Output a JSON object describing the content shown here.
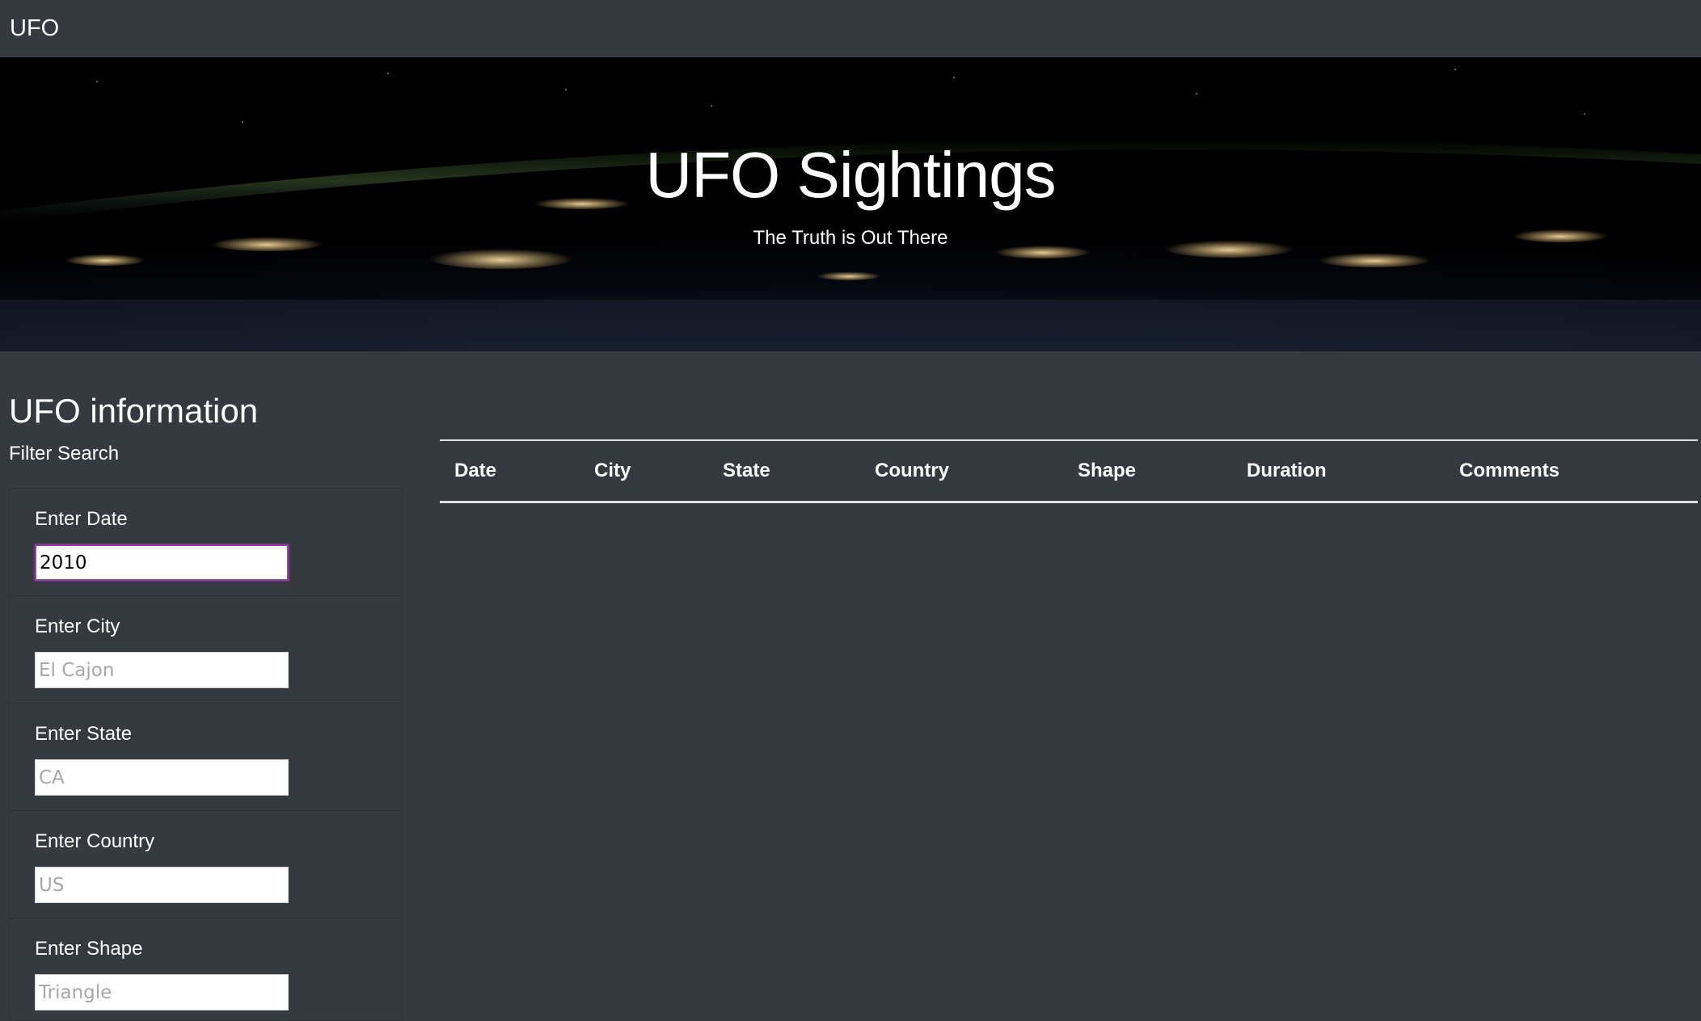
{
  "navbar": {
    "brand": "UFO"
  },
  "hero": {
    "title": "UFO Sightings",
    "subtitle": "The Truth is Out There"
  },
  "main": {
    "section_title": "UFO information",
    "filter_title": "Filter Search"
  },
  "filters": [
    {
      "label": "Enter Date",
      "value": "2010",
      "placeholder": ""
    },
    {
      "label": "Enter City",
      "value": "",
      "placeholder": "El Cajon"
    },
    {
      "label": "Enter State",
      "value": "",
      "placeholder": "CA"
    },
    {
      "label": "Enter Country",
      "value": "",
      "placeholder": "US"
    },
    {
      "label": "Enter Shape",
      "value": "",
      "placeholder": "Triangle"
    }
  ],
  "table": {
    "headers": [
      "Date",
      "City",
      "State",
      "Country",
      "Shape",
      "Duration",
      "Comments"
    ],
    "rows": []
  },
  "colors": {
    "page_background": "#343a40",
    "text": "#ffffff",
    "focus_border": "#9b3fa8"
  }
}
